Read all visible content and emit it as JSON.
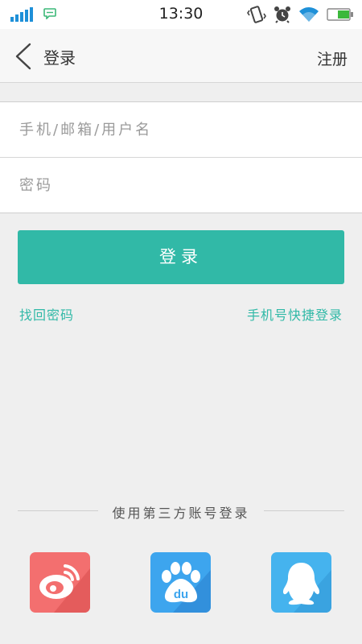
{
  "status": {
    "time": "13:30"
  },
  "header": {
    "title": "登录",
    "register": "注册"
  },
  "form": {
    "account_placeholder": "手机/邮箱/用户名",
    "password_placeholder": "密码"
  },
  "login_button": "登录",
  "links": {
    "forgot": "找回密码",
    "quick_login": "手机号快捷登录"
  },
  "third_party": {
    "title": "使用第三方账号登录",
    "providers": [
      {
        "name": "weibo",
        "color": "#f36f6f"
      },
      {
        "name": "baidu",
        "color": "#3d8fe4",
        "label": "du"
      },
      {
        "name": "qq",
        "color": "#45b3ee"
      }
    ]
  }
}
